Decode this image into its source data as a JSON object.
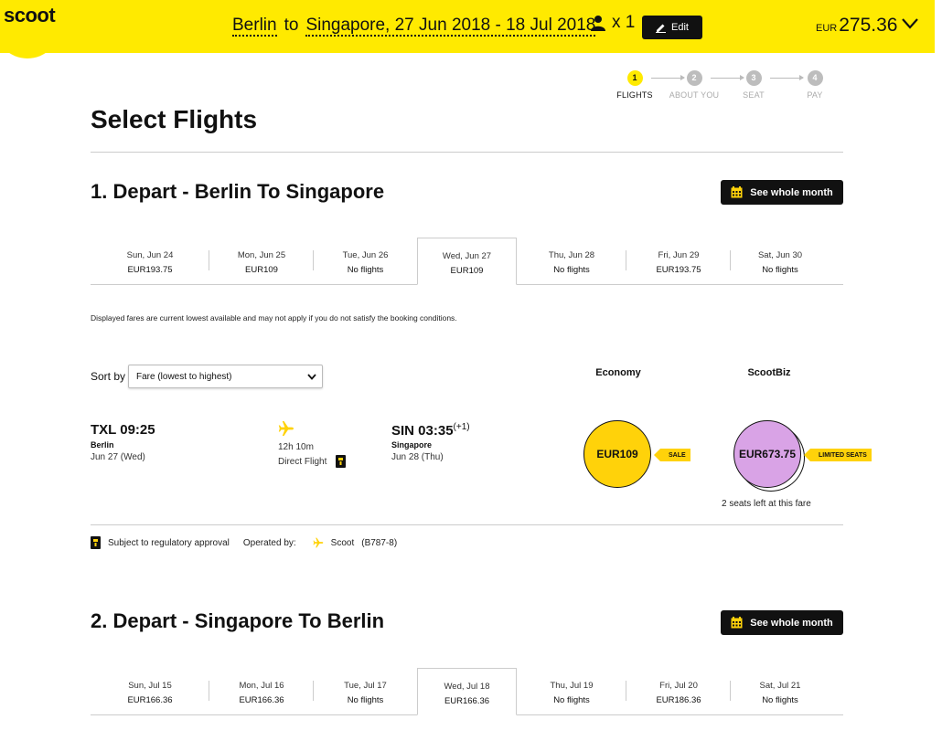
{
  "header": {
    "logo": "scoot",
    "origin": "Berlin",
    "to_word": "to",
    "destination_dates": "Singapore, 27 Jun 2018 - 18 Jul 2018",
    "pax_count": "x 1",
    "edit_label": "Edit",
    "currency": "EUR",
    "total": "275.36",
    "brand_color": "#ffea00"
  },
  "steps": [
    {
      "num": "1",
      "label": "FLIGHTS",
      "active": true
    },
    {
      "num": "2",
      "label": "ABOUT YOU",
      "active": false
    },
    {
      "num": "3",
      "label": "SEAT",
      "active": false
    },
    {
      "num": "4",
      "label": "PAY",
      "active": false
    }
  ],
  "page_title": "Select Flights",
  "depart1": {
    "title": "1. Depart - Berlin To Singapore",
    "month_btn": "See whole month",
    "tabs": [
      {
        "day": "Sun, Jun 24",
        "fare": "EUR193.75"
      },
      {
        "day": "Mon, Jun 25",
        "fare": "EUR109"
      },
      {
        "day": "Tue, Jun 26",
        "fare": "No flights"
      },
      {
        "day": "Wed, Jun 27",
        "fare": "EUR109"
      },
      {
        "day": "Thu, Jun 28",
        "fare": "No flights"
      },
      {
        "day": "Fri, Jun 29",
        "fare": "EUR193.75"
      },
      {
        "day": "Sat, Jun 30",
        "fare": "No flights"
      }
    ]
  },
  "disclaimer": "Displayed fares are current lowest available and may not apply if you do not satisfy the booking conditions.",
  "sort": {
    "label": "Sort by",
    "value": "Fare (lowest to highest)"
  },
  "columns": {
    "economy": "Economy",
    "scootbiz": "ScootBiz"
  },
  "flight": {
    "dep_code_time": "TXL 09:25",
    "dep_city": "Berlin",
    "dep_date": "Jun 27 (Wed)",
    "duration": "12h 10m",
    "direct": "Direct Flight",
    "arr_code_time": "SIN 03:35",
    "arr_offset": "(+1)",
    "arr_city": "Singapore",
    "arr_date": "Jun 28 (Thu)",
    "economy_fare": "EUR109",
    "economy_tag": "SALE",
    "biz_fare": "EUR673.75",
    "biz_tag": "LIMITED SEATS",
    "seats_left": "2 seats left at this fare"
  },
  "footnote": {
    "regulatory": "Subject to regulatory approval",
    "operated_by": "Operated by:",
    "operator": "Scoot",
    "aircraft": "(B787-8)"
  },
  "depart2": {
    "title": "2. Depart - Singapore To Berlin",
    "month_btn": "See whole month",
    "tabs": [
      {
        "day": "Sun, Jul 15",
        "fare": "EUR166.36"
      },
      {
        "day": "Mon, Jul 16",
        "fare": "EUR166.36"
      },
      {
        "day": "Tue, Jul 17",
        "fare": "No flights"
      },
      {
        "day": "Wed, Jul 18",
        "fare": "EUR166.36"
      },
      {
        "day": "Thu, Jul 19",
        "fare": "No flights"
      },
      {
        "day": "Fri, Jul 20",
        "fare": "EUR186.36"
      },
      {
        "day": "Sat, Jul 21",
        "fare": "No flights"
      }
    ]
  }
}
